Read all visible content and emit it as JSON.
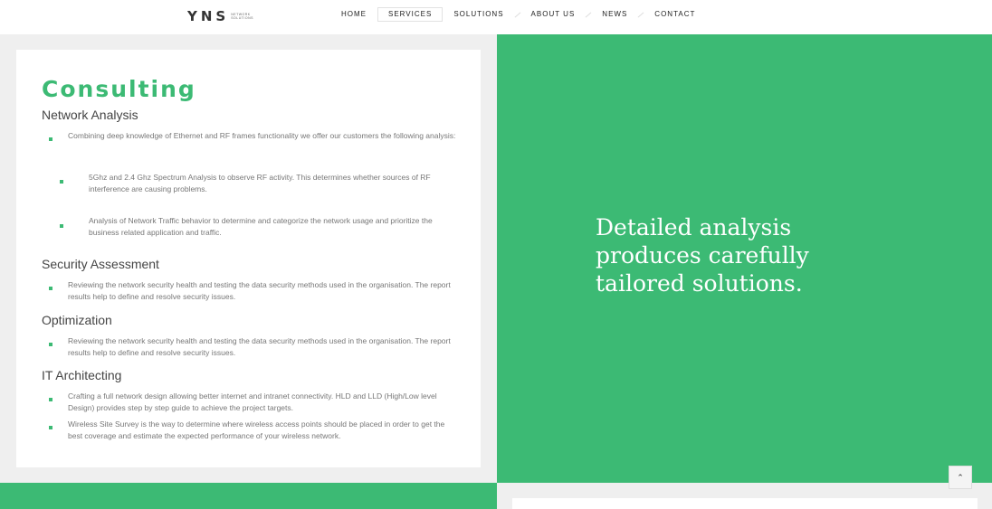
{
  "logo": {
    "mark": "YNS",
    "subtitle": "NETWORK SOLUTIONS"
  },
  "nav": {
    "items": [
      {
        "label": "HOME"
      },
      {
        "label": "SERVICES"
      },
      {
        "label": "SOLUTIONS"
      },
      {
        "label": "ABOUT US"
      },
      {
        "label": "NEWS"
      },
      {
        "label": "CONTACT"
      }
    ],
    "active": "SERVICES"
  },
  "content": {
    "title": "Consulting",
    "sections": [
      {
        "heading": "Network Analysis",
        "items": [
          "Combining deep knowledge of Ethernet and RF frames functionality we offer our customers the following analysis:",
          "5Ghz and 2.4 Ghz Spectrum Analysis to observe RF activity. This determines whether sources of RF interference are causing problems.",
          "Analysis of Network Traffic behavior to determine and categorize the network usage and prioritize the business related application and traffic."
        ]
      },
      {
        "heading": "Security Assessment",
        "items": [
          "Reviewing the network security health and testing the data security methods used in the organisation. The report results help to define and resolve security issues."
        ]
      },
      {
        "heading": "Optimization",
        "items": [
          "Reviewing the network security health and testing the data security methods used in the organisation. The report results help to define and resolve security issues."
        ]
      },
      {
        "heading": "IT Architecting",
        "items": [
          "Crafting a full network design allowing better internet and intranet connectivity. HLD and LLD (High/Low level Design) provides step by step guide to achieve the project targets.",
          "Wireless Site Survey is the way to determine where wireless access points should be placed in order to get the best coverage and estimate the expected performance of your wireless network."
        ]
      }
    ]
  },
  "hero": {
    "tagline": "Detailed analysis produces carefully tailored solutions."
  },
  "scroll_top": {
    "icon": "chevron-up-icon",
    "glyph": "⌃"
  },
  "colors": {
    "accent": "#3cba74",
    "background": "#efefef",
    "card": "#ffffff"
  }
}
